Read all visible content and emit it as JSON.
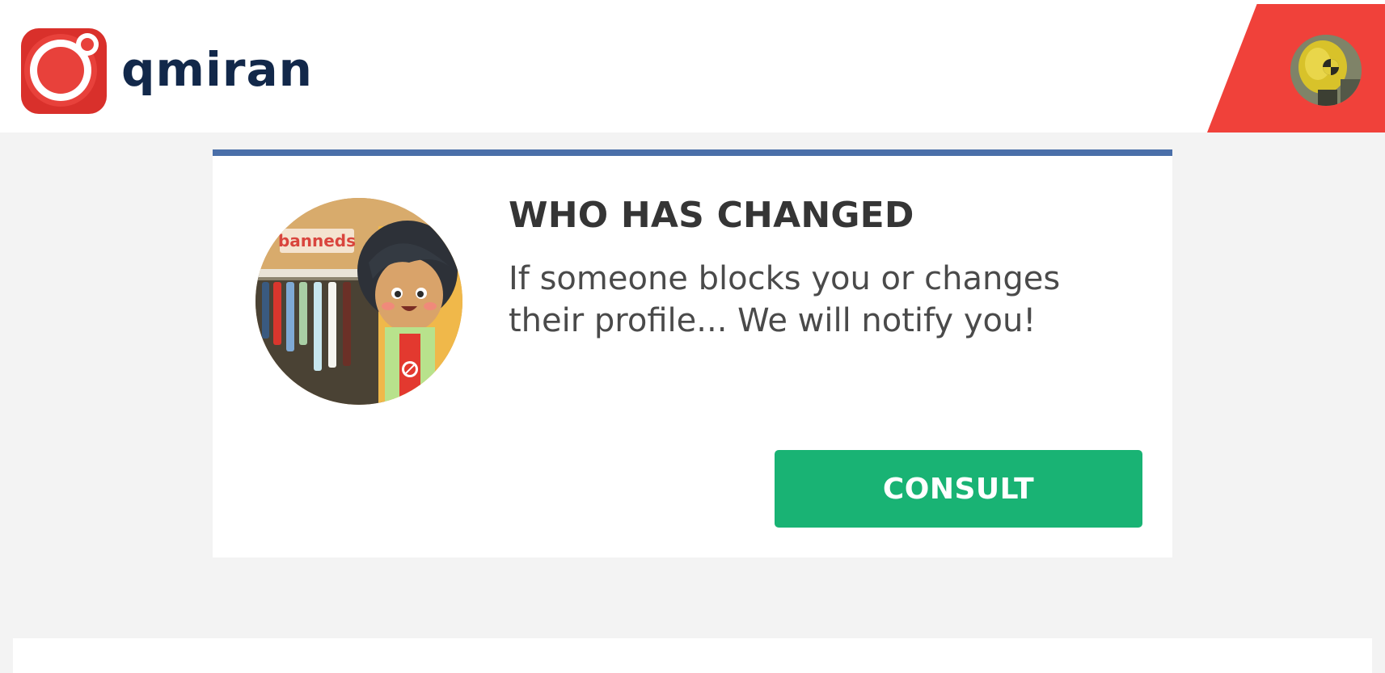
{
  "app": {
    "brand": "qmiran",
    "logo_icon": "qmiran-logo-icon",
    "avatar_icon": "user-avatar-icon"
  },
  "colors": {
    "brand_red": "#f0413a",
    "brand_navy": "#12284a",
    "card_accent": "#4a6fa9",
    "button_green": "#19b374",
    "page_bg": "#f3f3f3"
  },
  "card": {
    "illustration_label": "banneds",
    "title": "WHO HAS CHANGED",
    "description": "If someone blocks you or changes their profile... We will notify you!",
    "button_label": "CONSULT"
  }
}
